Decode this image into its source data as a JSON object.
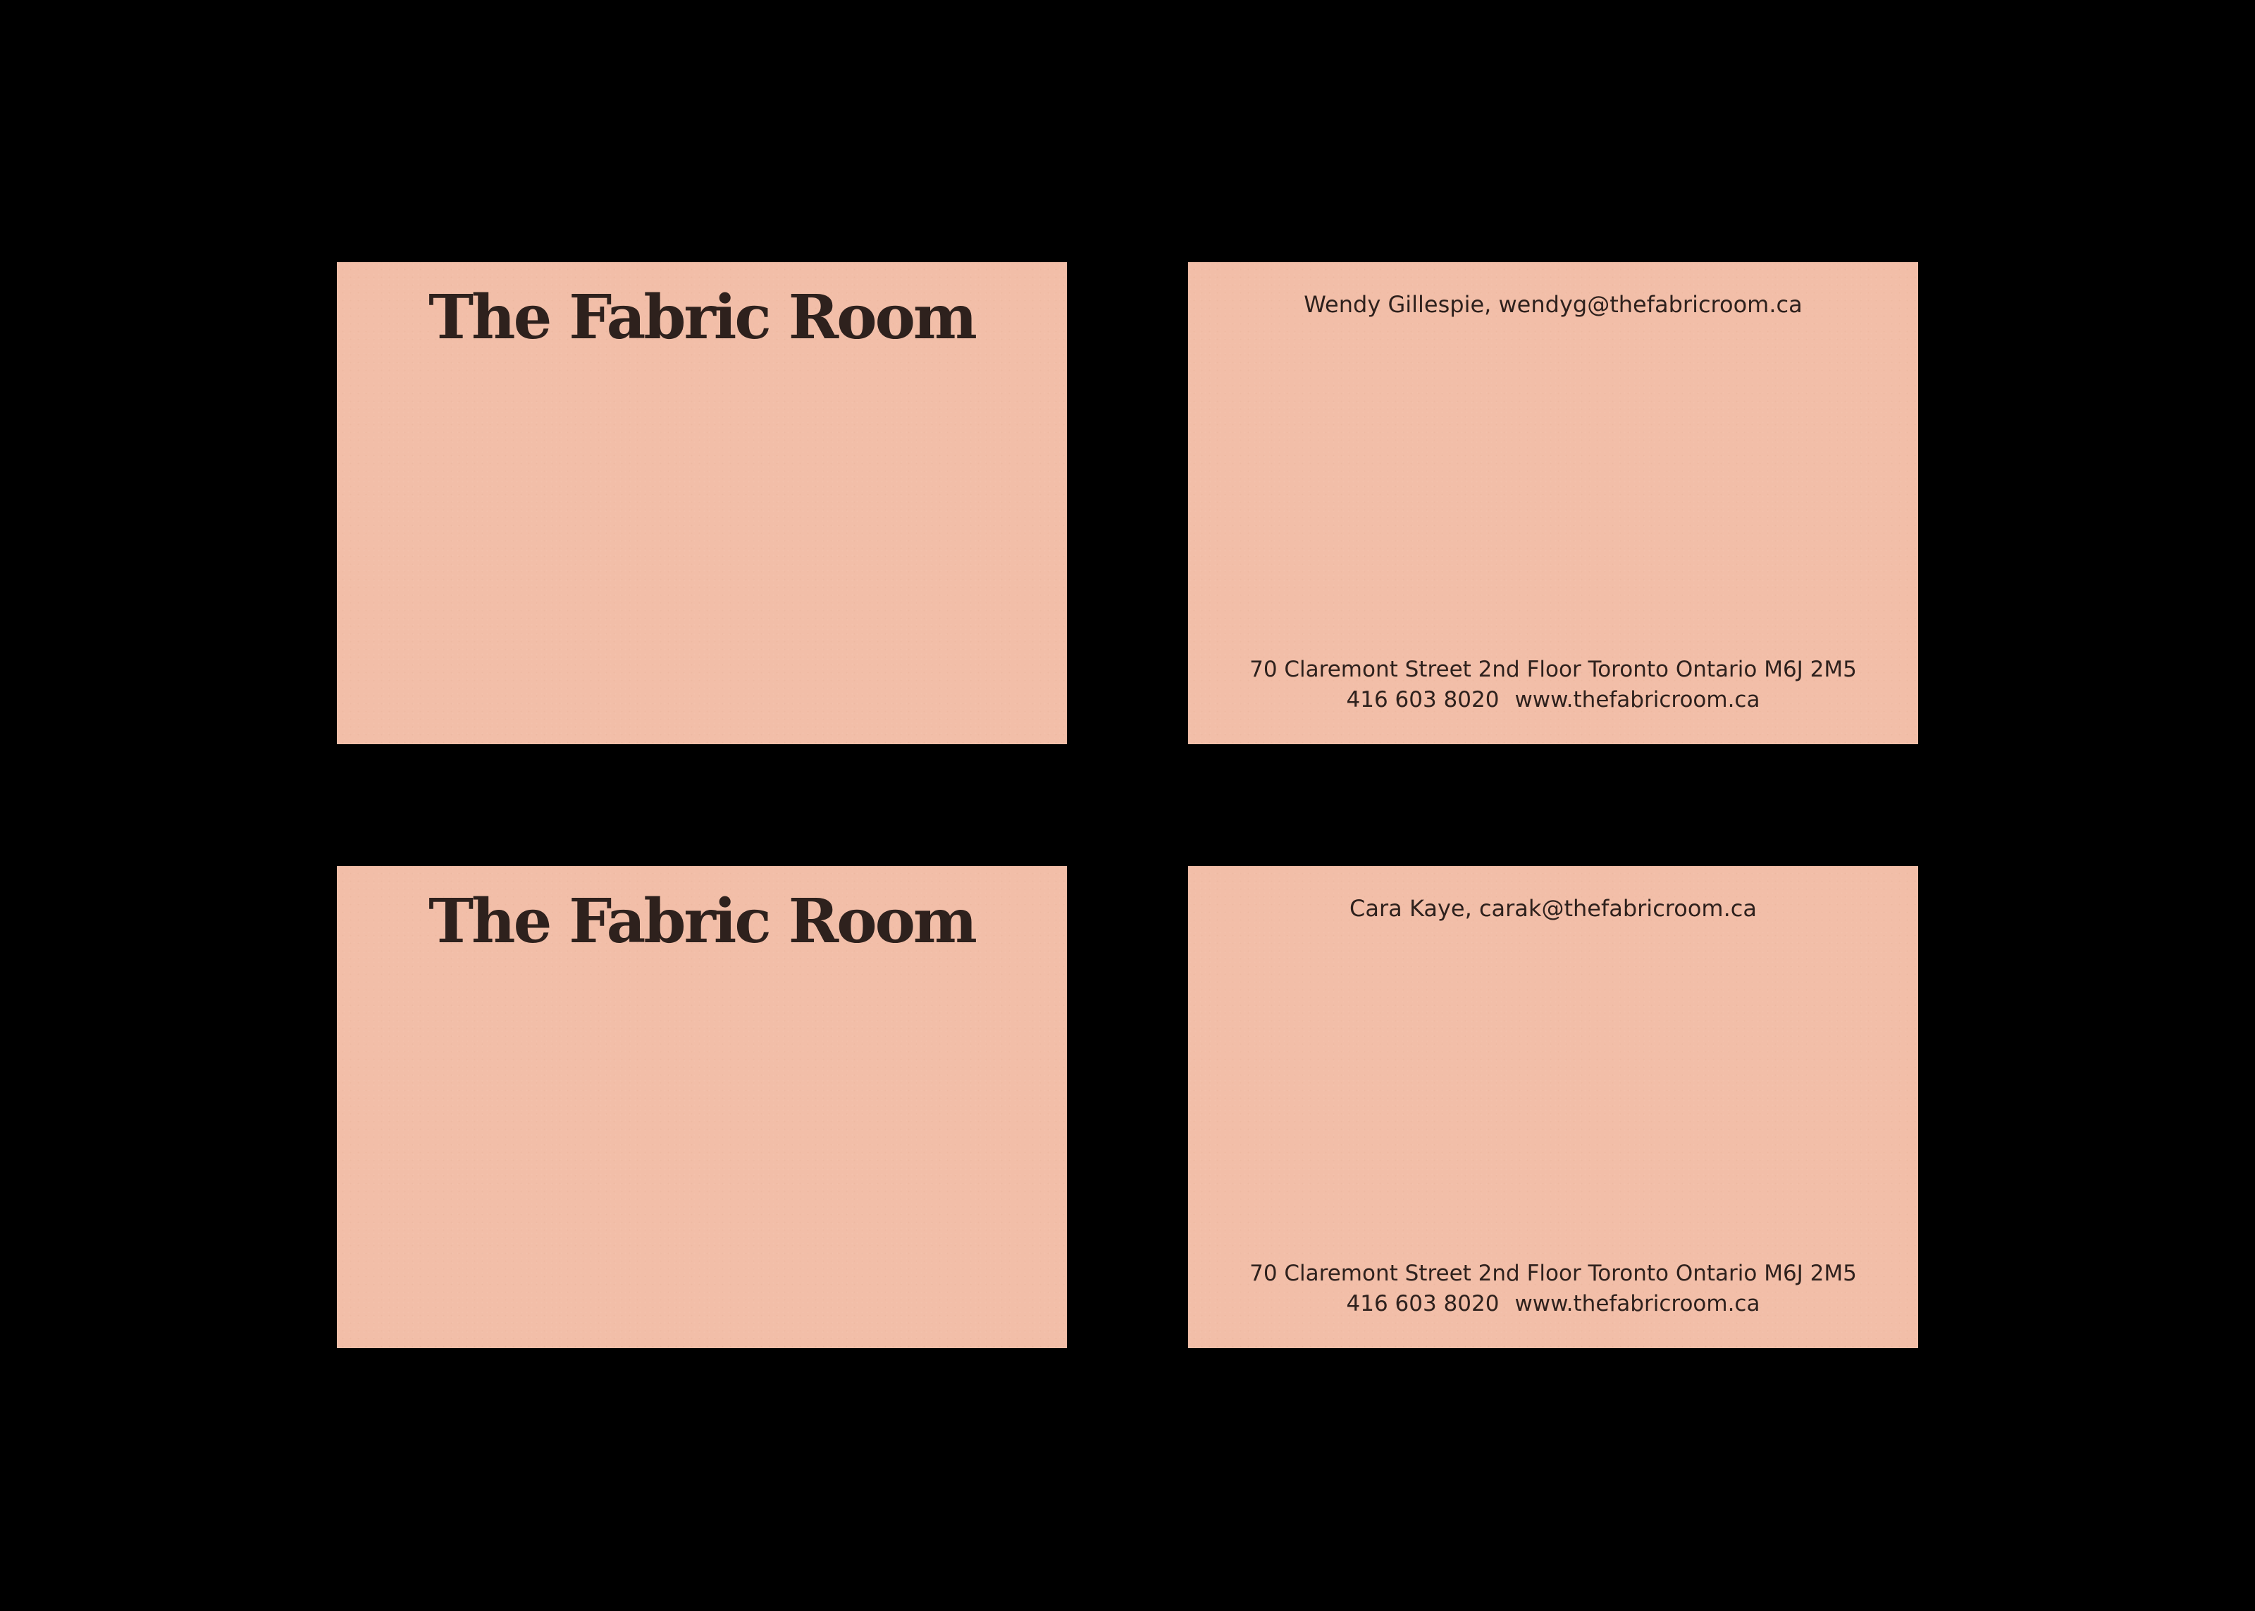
{
  "background_color": "#000000",
  "card_color": "#f2bea8",
  "ink_color": "#2e211d",
  "cards": {
    "front_1": {
      "logo": "The Fabric Room"
    },
    "back_1": {
      "contact": "Wendy Gillespie, wendyg@thefabricroom.ca",
      "address": "70 Claremont Street 2nd Floor Toronto Ontario M6J 2M5",
      "phone": "416 603 8020",
      "website": "www.thefabricroom.ca"
    },
    "front_2": {
      "logo": "The Fabric Room"
    },
    "back_2": {
      "contact": "Cara Kaye, carak@thefabricroom.ca",
      "address": "70 Claremont Street 2nd Floor Toronto Ontario M6J 2M5",
      "phone": "416 603 8020",
      "website": "www.thefabricroom.ca"
    }
  }
}
